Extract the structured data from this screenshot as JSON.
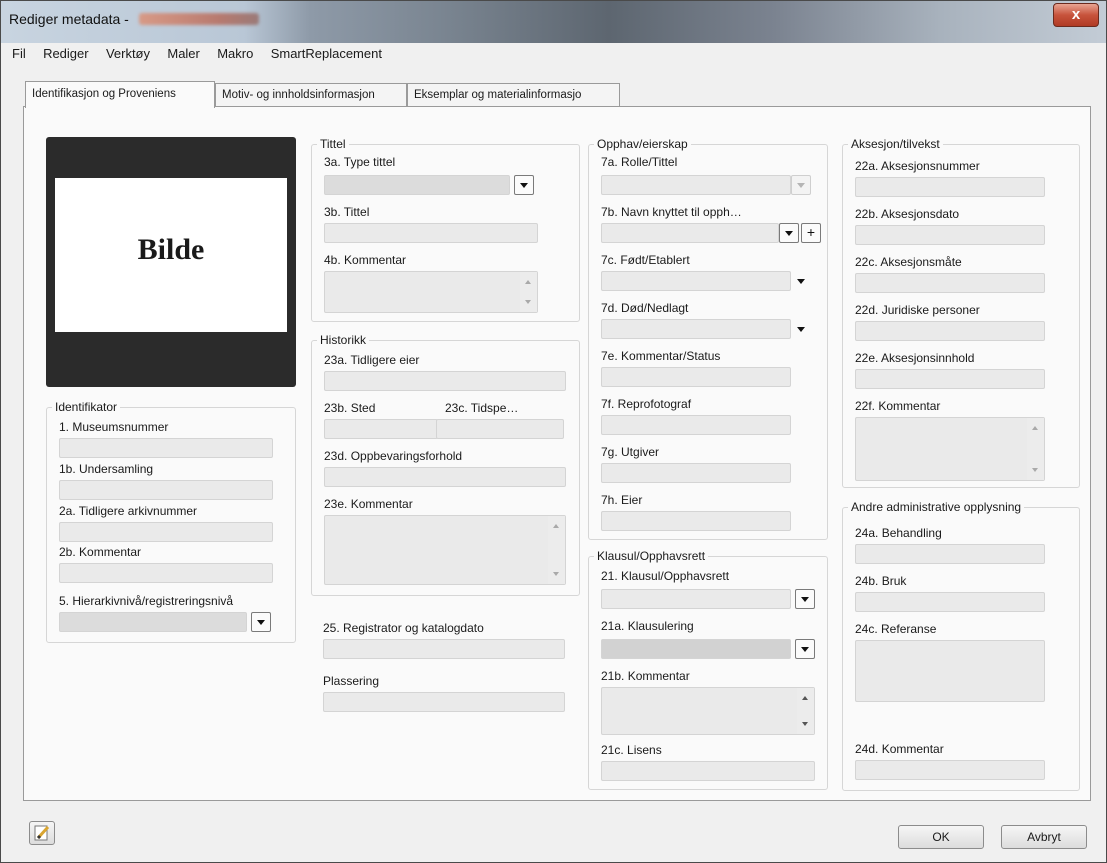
{
  "window": {
    "title": "Rediger metadata - ",
    "close_label": "x"
  },
  "menu": [
    "Fil",
    "Rediger",
    "Verktøy",
    "Maler",
    "Makro",
    "SmartReplacement"
  ],
  "tabs": [
    {
      "label": "Identifikasjon og Proveniens",
      "active": true
    },
    {
      "label": "Motiv- og innholdsinformasjon",
      "active": false
    },
    {
      "label": "Eksemplar og materialinformasjo",
      "active": false
    }
  ],
  "picture": {
    "label": "Bilde"
  },
  "identifikator": {
    "title": "Identifikator",
    "museumsnummer": "1. Museumsnummer",
    "undersamling": "1b. Undersamling",
    "tidligere_arkivnummer": "2a. Tidligere arkivnummer",
    "kommentar": "2b. Kommentar",
    "hierarki": "5. Hierarkivnivå/registreringsnivå"
  },
  "tittel": {
    "title": "Tittel",
    "type_tittel": "3a. Type tittel",
    "tittel": "3b. Tittel",
    "kommentar": "4b. Kommentar"
  },
  "historikk": {
    "title": "Historikk",
    "tidligere_eier": "23a. Tidligere eier",
    "sted": "23b. Sted",
    "tidsperiode": "23c. Tidspe…",
    "oppbevaringsforhold": "23d. Oppbevaringsforhold",
    "kommentar": "23e. Kommentar"
  },
  "registrator": "25. Registrator og katalogdato",
  "plassering": "Plassering",
  "opphav": {
    "title": "Opphav/eierskap",
    "rolle": "7a. Rolle/Tittel",
    "navn": "7b. Navn knyttet til opph…",
    "fodt": "7c. Født/Etablert",
    "dod": "7d. Død/Nedlagt",
    "kommentar": "7e. Kommentar/Status",
    "reprofotograf": "7f. Reprofotograf",
    "utgiver": "7g. Utgiver",
    "eier": "7h. Eier"
  },
  "klausul": {
    "title": "Klausul/Opphavsrett",
    "klausul": "21. Klausul/Opphavsrett",
    "klausulering": "21a. Klausulering",
    "kommentar": "21b. Kommentar",
    "lisens": "21c. Lisens"
  },
  "aksesjon": {
    "title": "Aksesjon/tilvekst",
    "nummer": "22a. Aksesjonsnummer",
    "dato": "22b. Aksesjonsdato",
    "mate": "22c. Aksesjonsmåte",
    "juridiske": "22d. Juridiske personer",
    "innhold": "22e. Aksesjonsinnhold",
    "kommentar": "22f. Kommentar"
  },
  "andre": {
    "title": "Andre administrative opplysning",
    "behandling": "24a. Behandling",
    "bruk": "24b. Bruk",
    "referanse": "24c. Referanse",
    "kommentar": "24d. Kommentar"
  },
  "buttons": {
    "ok": "OK",
    "cancel": "Avbryt"
  },
  "colors": {
    "field": "#eaeaea",
    "panel": "#fafafa",
    "window": "#f0f0f0",
    "close": "#c7533c"
  }
}
